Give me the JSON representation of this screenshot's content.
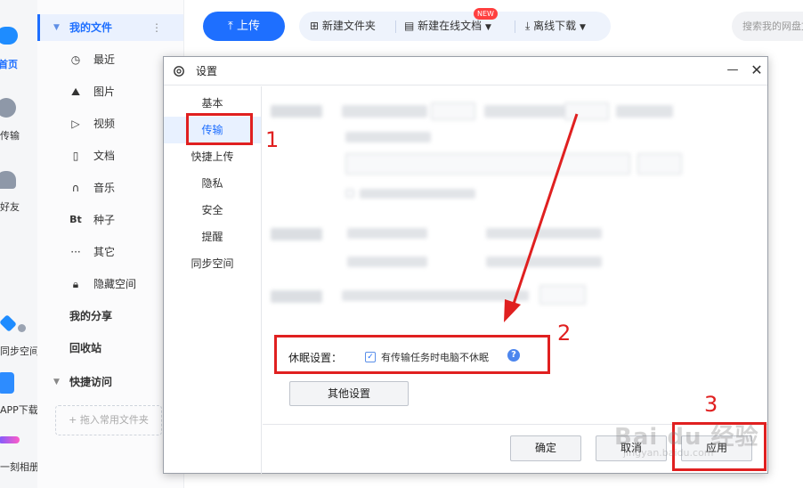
{
  "rail": {
    "home": "首页",
    "transfer": "传输",
    "friends": "好友",
    "sync": "同步空间",
    "app_download": "APP下载",
    "album": "一刻相册"
  },
  "sidebar": {
    "my_files": "我的文件",
    "recent": "最近",
    "pictures": "图片",
    "videos": "视频",
    "docs": "文档",
    "music": "音乐",
    "bt": "种子",
    "other": "其它",
    "hidden": "隐藏空间",
    "my_share": "我的分享",
    "recycle": "回收站",
    "quick_access": "快捷访问",
    "drop_hint": "+ 拖入常用文件夹",
    "bt_icon_text": "Bt"
  },
  "toolbar": {
    "upload": "上传",
    "new_folder": "新建文件夹",
    "new_online_doc": "新建在线文档",
    "new_badge": "NEW",
    "offline_download": "离线下载",
    "search_placeholder": "搜索我的网盘文件"
  },
  "dialog": {
    "title": "设置",
    "nav": [
      "基本",
      "传输",
      "快捷上传",
      "隐私",
      "安全",
      "提醒",
      "同步空间"
    ],
    "sleep_label": "休眠设置：",
    "sleep_option": "有传输任务时电脑不休眠",
    "sleep_checked": "✓",
    "help": "?",
    "other_settings": "其他设置",
    "ok": "确定",
    "cancel": "取消",
    "apply": "应用"
  },
  "annotations": [
    "1",
    "2",
    "3"
  ],
  "watermark": {
    "main": "Bai du 经验",
    "sub": "jingyan.baidu.com"
  },
  "colors": {
    "accent": "#1e6fff",
    "annotation": "#e02020"
  }
}
